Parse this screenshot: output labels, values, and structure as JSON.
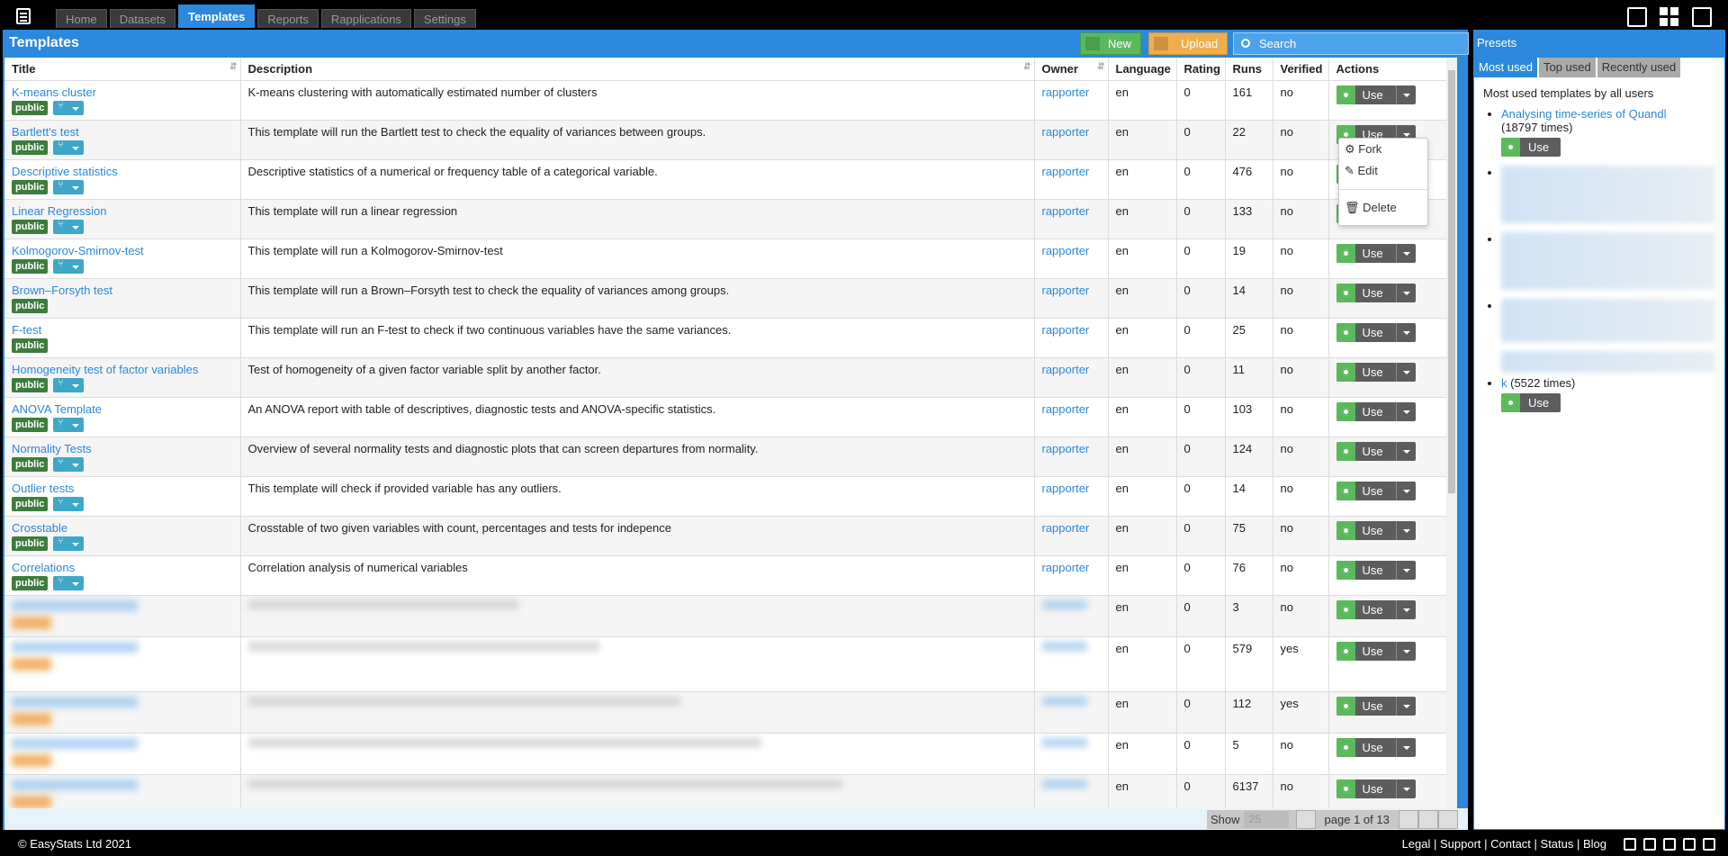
{
  "nav": {
    "tabs": [
      "Home",
      "Datasets",
      "Templates",
      "Reports",
      "Rapplications",
      "Settings"
    ],
    "active": "Templates"
  },
  "main": {
    "title": "Templates",
    "new_label": "New",
    "upload_label": "Upload",
    "search_placeholder": "Search"
  },
  "columns": [
    "Title",
    "Description",
    "Owner",
    "Language",
    "Rating",
    "Runs",
    "Verified",
    "Actions"
  ],
  "rows": [
    {
      "title": "K-means cluster",
      "badge": "public",
      "desc": "K-means clustering with automatically estimated number of clusters",
      "owner": "rapporter",
      "lang": "en",
      "rating": "0",
      "runs": "161",
      "verified": "no"
    },
    {
      "title": "Bartlett's test",
      "badge": "public",
      "desc": "This template will run the Bartlett test to check the equality of variances between groups.",
      "owner": "rapporter",
      "lang": "en",
      "rating": "0",
      "runs": "22",
      "verified": "no"
    },
    {
      "title": "Descriptive statistics",
      "badge": "public",
      "desc": "Descriptive statistics of a numerical or frequency table of a categorical variable.",
      "owner": "rapporter",
      "lang": "en",
      "rating": "0",
      "runs": "476",
      "verified": "no"
    },
    {
      "title": "Linear Regression",
      "badge": "public",
      "desc": "This template will run a linear regression",
      "owner": "rapporter",
      "lang": "en",
      "rating": "0",
      "runs": "133",
      "verified": "no"
    },
    {
      "title": "Kolmogorov-Smirnov-test",
      "badge": "public",
      "desc": "This template will run a Kolmogorov-Smirnov-test",
      "owner": "rapporter",
      "lang": "en",
      "rating": "0",
      "runs": "19",
      "verified": "no"
    },
    {
      "title": "Brown–Forsyth test",
      "badge": "public",
      "desc": "This template will run a Brown–Forsyth test to check the equality of variances among groups.",
      "owner": "rapporter",
      "lang": "en",
      "rating": "0",
      "runs": "14",
      "verified": "no"
    },
    {
      "title": "F-test",
      "badge": "public",
      "desc": "This template will run an F-test to check if two continuous variables have the same variances.",
      "owner": "rapporter",
      "lang": "en",
      "rating": "0",
      "runs": "25",
      "verified": "no"
    },
    {
      "title": "Homogeneity test of factor variables",
      "badge": "public",
      "desc": "Test of homogeneity of a given factor variable split by another factor.",
      "owner": "rapporter",
      "lang": "en",
      "rating": "0",
      "runs": "11",
      "verified": "no"
    },
    {
      "title": "ANOVA Template",
      "badge": "public",
      "desc": "An ANOVA report with table of descriptives, diagnostic tests and ANOVA-specific statistics.",
      "owner": "rapporter",
      "lang": "en",
      "rating": "0",
      "runs": "103",
      "verified": "no"
    },
    {
      "title": "Normality Tests",
      "badge": "public",
      "desc": "Overview of several normality tests and diagnostic plots that can screen departures from normality.",
      "owner": "rapporter",
      "lang": "en",
      "rating": "0",
      "runs": "124",
      "verified": "no"
    },
    {
      "title": "Outlier tests",
      "badge": "public",
      "desc": "This template will check if provided variable has any outliers.",
      "owner": "rapporter",
      "lang": "en",
      "rating": "0",
      "runs": "14",
      "verified": "no"
    },
    {
      "title": "Crosstable",
      "badge": "public",
      "desc": "Crosstable of two given variables with count, percentages and tests for indepence",
      "owner": "rapporter",
      "lang": "en",
      "rating": "0",
      "runs": "75",
      "verified": "no"
    },
    {
      "title": "Correlations",
      "badge": "public",
      "desc": "Correlation analysis of numerical variables",
      "owner": "rapporter",
      "lang": "en",
      "rating": "0",
      "runs": "76",
      "verified": "no"
    }
  ],
  "blurred_rows": [
    {
      "lang": "en",
      "rating": "0",
      "runs": "3",
      "verified": "no"
    },
    {
      "lang": "en",
      "rating": "0",
      "runs": "579",
      "verified": "yes"
    },
    {
      "lang": "en",
      "rating": "0",
      "runs": "112",
      "verified": "yes"
    },
    {
      "lang": "en",
      "rating": "0",
      "runs": "5",
      "verified": "no"
    },
    {
      "lang": "en",
      "rating": "0",
      "runs": "6137",
      "verified": "no",
      "badge": "private"
    }
  ],
  "use_label": "Use",
  "dropdown": {
    "fork": "Fork",
    "edit": "Edit",
    "delete": "Delete"
  },
  "pager": {
    "show": "Show",
    "per_page": "25",
    "info": "page 1 of 13"
  },
  "presets": {
    "title": "Presets",
    "tabs": [
      "Most used",
      "Top used",
      "Recently used"
    ],
    "heading": "Most used templates by all users",
    "item1_title": "Analysing time-series of Quandl",
    "item1_count": "(18797 times)",
    "item_last_title": "k",
    "item_last_count": "(5522 times)"
  },
  "footer": {
    "copyright": "© EasyStats Ltd 2021",
    "links": "Legal | Support | Contact | Status | Blog"
  }
}
